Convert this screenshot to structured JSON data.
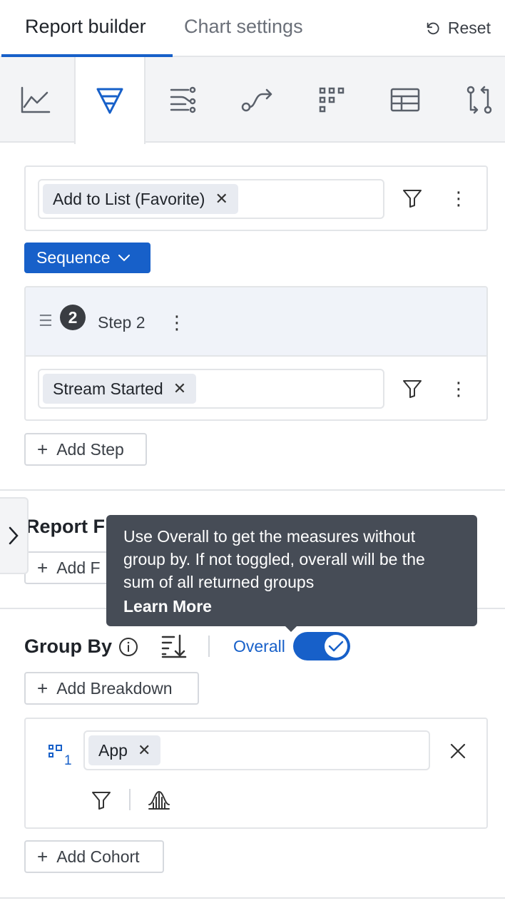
{
  "tabs": {
    "active": "Report builder",
    "inactive": "Chart settings",
    "reset": "Reset"
  },
  "toolbar": {
    "items": [
      {
        "icon": "line-chart-icon",
        "active": false
      },
      {
        "icon": "funnel-icon",
        "active": true
      },
      {
        "icon": "flow-icon",
        "active": false
      },
      {
        "icon": "path-icon",
        "active": false
      },
      {
        "icon": "grid-icon",
        "active": false
      },
      {
        "icon": "table-icon",
        "active": false
      },
      {
        "icon": "compare-icon",
        "active": false
      }
    ]
  },
  "step1": {
    "event": "Add to List (Favorite)"
  },
  "sequence_label": "Sequence",
  "step2": {
    "number": "2",
    "label": "Step 2",
    "event": "Stream Started"
  },
  "add_step": "Add Step",
  "report_filters": {
    "title": "Report F",
    "add_label": "Add F"
  },
  "tooltip": {
    "line1": "Use Overall to get the measures without",
    "line2": "group by. If not toggled, overall will be the",
    "line3": "sum of all returned groups",
    "learn_more": "Learn More"
  },
  "group_by": {
    "title": "Group By",
    "overall_label": "Overall",
    "overall_enabled": true,
    "add_breakdown": "Add Breakdown",
    "breakdown_index": "1",
    "breakdown_value": "App",
    "add_cohort": "Add Cohort"
  },
  "colors": {
    "accent": "#1760c9",
    "tooltip_bg": "#464c56"
  }
}
